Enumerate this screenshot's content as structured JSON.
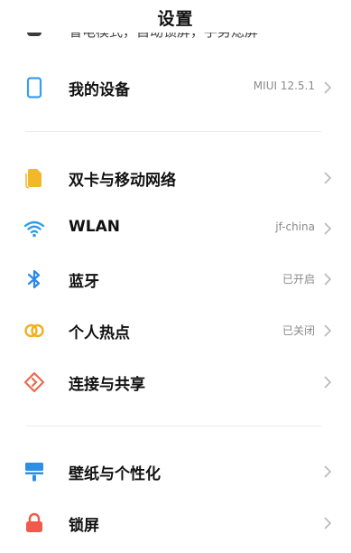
{
  "header": {
    "title": "设置"
  },
  "clipped_item": {
    "label": "省电模式，自动锁屏，手势熄屏"
  },
  "sections": [
    {
      "items": [
        {
          "key": "my_device",
          "label": "我的设备",
          "value": "MIUI 12.5.1",
          "icon": "phone-outline-icon",
          "color": "#3a9cf0"
        }
      ]
    },
    {
      "items": [
        {
          "key": "dual_sim",
          "label": "双卡与移动网络",
          "value": "",
          "icon": "sim-card-icon",
          "color": "#f2b829"
        },
        {
          "key": "wlan",
          "label": "WLAN",
          "value": "jf-china",
          "icon": "wifi-icon",
          "color": "#2c9ee8"
        },
        {
          "key": "bluetooth",
          "label": "蓝牙",
          "value": "已开启",
          "icon": "bluetooth-icon",
          "color": "#2c86e8"
        },
        {
          "key": "hotspot",
          "label": "个人热点",
          "value": "已关闭",
          "icon": "hotspot-icon",
          "color": "#f0b020"
        },
        {
          "key": "connection_share",
          "label": "连接与共享",
          "value": "",
          "icon": "share-diamond-icon",
          "color": "#ea6a4e"
        }
      ]
    },
    {
      "items": [
        {
          "key": "wallpaper",
          "label": "壁纸与个性化",
          "value": "",
          "icon": "brush-icon",
          "color": "#2b8fe6"
        },
        {
          "key": "lock_screen",
          "label": "锁屏",
          "value": "",
          "icon": "lock-icon",
          "color": "#ef5a4a"
        }
      ]
    }
  ],
  "chevron_color": "#b8b8b8"
}
